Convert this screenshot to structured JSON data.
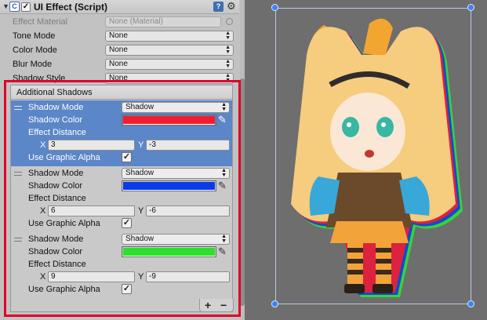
{
  "component": {
    "title": "UI Effect (Script)",
    "enabled_mark": "✓",
    "help_label": "?",
    "properties": [
      {
        "label": "Effect Material",
        "value": "None (Material)",
        "disabled": true
      },
      {
        "label": "Tone Mode",
        "value": "None"
      },
      {
        "label": "Color Mode",
        "value": "None"
      },
      {
        "label": "Blur Mode",
        "value": "None"
      },
      {
        "label": "Shadow Style",
        "value": "None"
      }
    ]
  },
  "additional_shadows": {
    "header": "Additional Shadows",
    "entries": [
      {
        "mode_label": "Shadow Mode",
        "mode_value": "Shadow",
        "color_label": "Shadow Color",
        "color": "#f21e2e",
        "distance_label": "Effect Distance",
        "x_label": "X",
        "x": "3",
        "y_label": "Y",
        "y": "-3",
        "alpha_label": "Use Graphic Alpha",
        "alpha_checked": "✓",
        "selected": true
      },
      {
        "mode_label": "Shadow Mode",
        "mode_value": "Shadow",
        "color_label": "Shadow Color",
        "color": "#0a3be6",
        "distance_label": "Effect Distance",
        "x_label": "X",
        "x": "6",
        "y_label": "Y",
        "y": "-6",
        "alpha_label": "Use Graphic Alpha",
        "alpha_checked": "✓",
        "selected": false
      },
      {
        "mode_label": "Shadow Mode",
        "mode_value": "Shadow",
        "color_label": "Shadow Color",
        "color": "#2de02d",
        "distance_label": "Effect Distance",
        "x_label": "X",
        "x": "9",
        "y_label": "Y",
        "y": "-9",
        "alpha_label": "Use Graphic Alpha",
        "alpha_checked": "✓",
        "selected": false
      }
    ],
    "add_label": "+",
    "remove_label": "−"
  },
  "colors": {
    "selection": "#5b86c8",
    "highlight_box": "#e2002a",
    "scene_bg": "#6e6e6e"
  }
}
